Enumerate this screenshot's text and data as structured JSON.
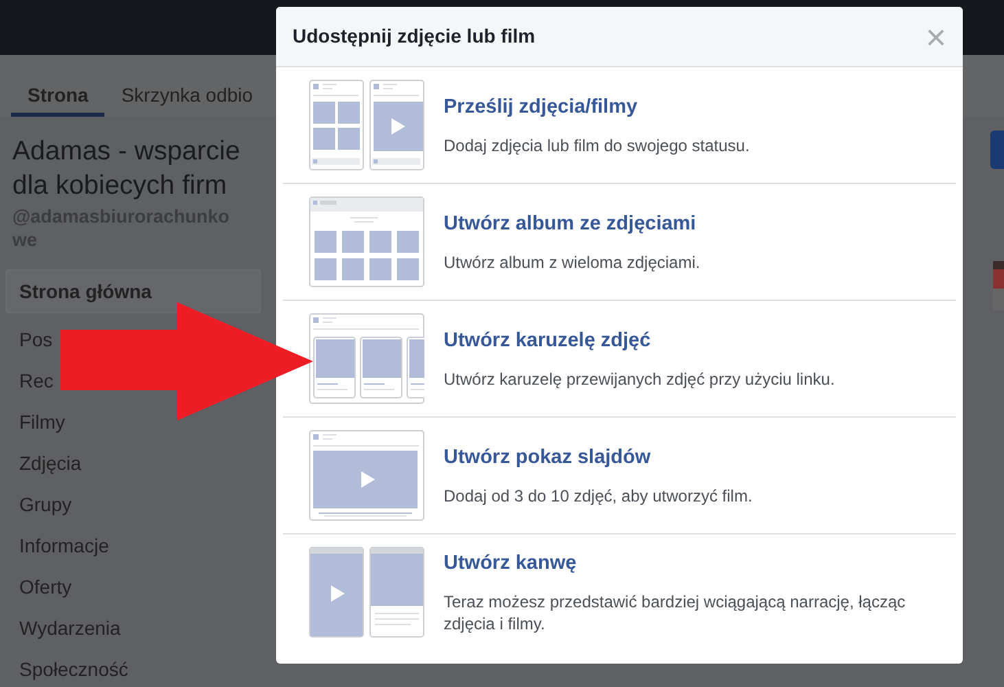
{
  "tabs": [
    {
      "label": "Strona",
      "selected": true
    },
    {
      "label": "Skrzynka odbio",
      "selected": false
    }
  ],
  "page": {
    "name": "Adamas - wsparcie dla kobiecych firm",
    "handle": "@adamasbiurorachunkowe"
  },
  "sidebar": {
    "items": [
      {
        "label": "Strona główna",
        "selected": true
      },
      {
        "label": "Pos",
        "selected": false
      },
      {
        "label": "Rec",
        "selected": false
      },
      {
        "label": "Filmy",
        "selected": false
      },
      {
        "label": "Zdjęcia",
        "selected": false
      },
      {
        "label": "Grupy",
        "selected": false
      },
      {
        "label": "Informacje",
        "selected": false
      },
      {
        "label": "Oferty",
        "selected": false
      },
      {
        "label": "Wydarzenia",
        "selected": false
      },
      {
        "label": "Społeczność",
        "selected": false
      }
    ]
  },
  "dialog": {
    "title": "Udostępnij zdjęcie lub film",
    "close": "×",
    "options": [
      {
        "kind": "upload",
        "title": "Prześlij zdjęcia/filmy",
        "description": "Dodaj zdjęcia lub film do swojego statusu."
      },
      {
        "kind": "album",
        "title": "Utwórz album ze zdjęciami",
        "description": "Utwórz album z wieloma zdjęciami."
      },
      {
        "kind": "carousel",
        "title": "Utwórz karuzelę zdjęć",
        "description": "Utwórz karuzelę przewijanych zdjęć przy użyciu linku."
      },
      {
        "kind": "slideshow",
        "title": "Utwórz pokaz slajdów",
        "description": "Dodaj od 3 do 10 zdjęć, aby utworzyć film."
      },
      {
        "kind": "canvas",
        "title": "Utwórz kanwę",
        "description": "Teraz możesz przedstawić bardziej wciągającą narrację, łącząc zdjęcia i filmy."
      }
    ]
  }
}
